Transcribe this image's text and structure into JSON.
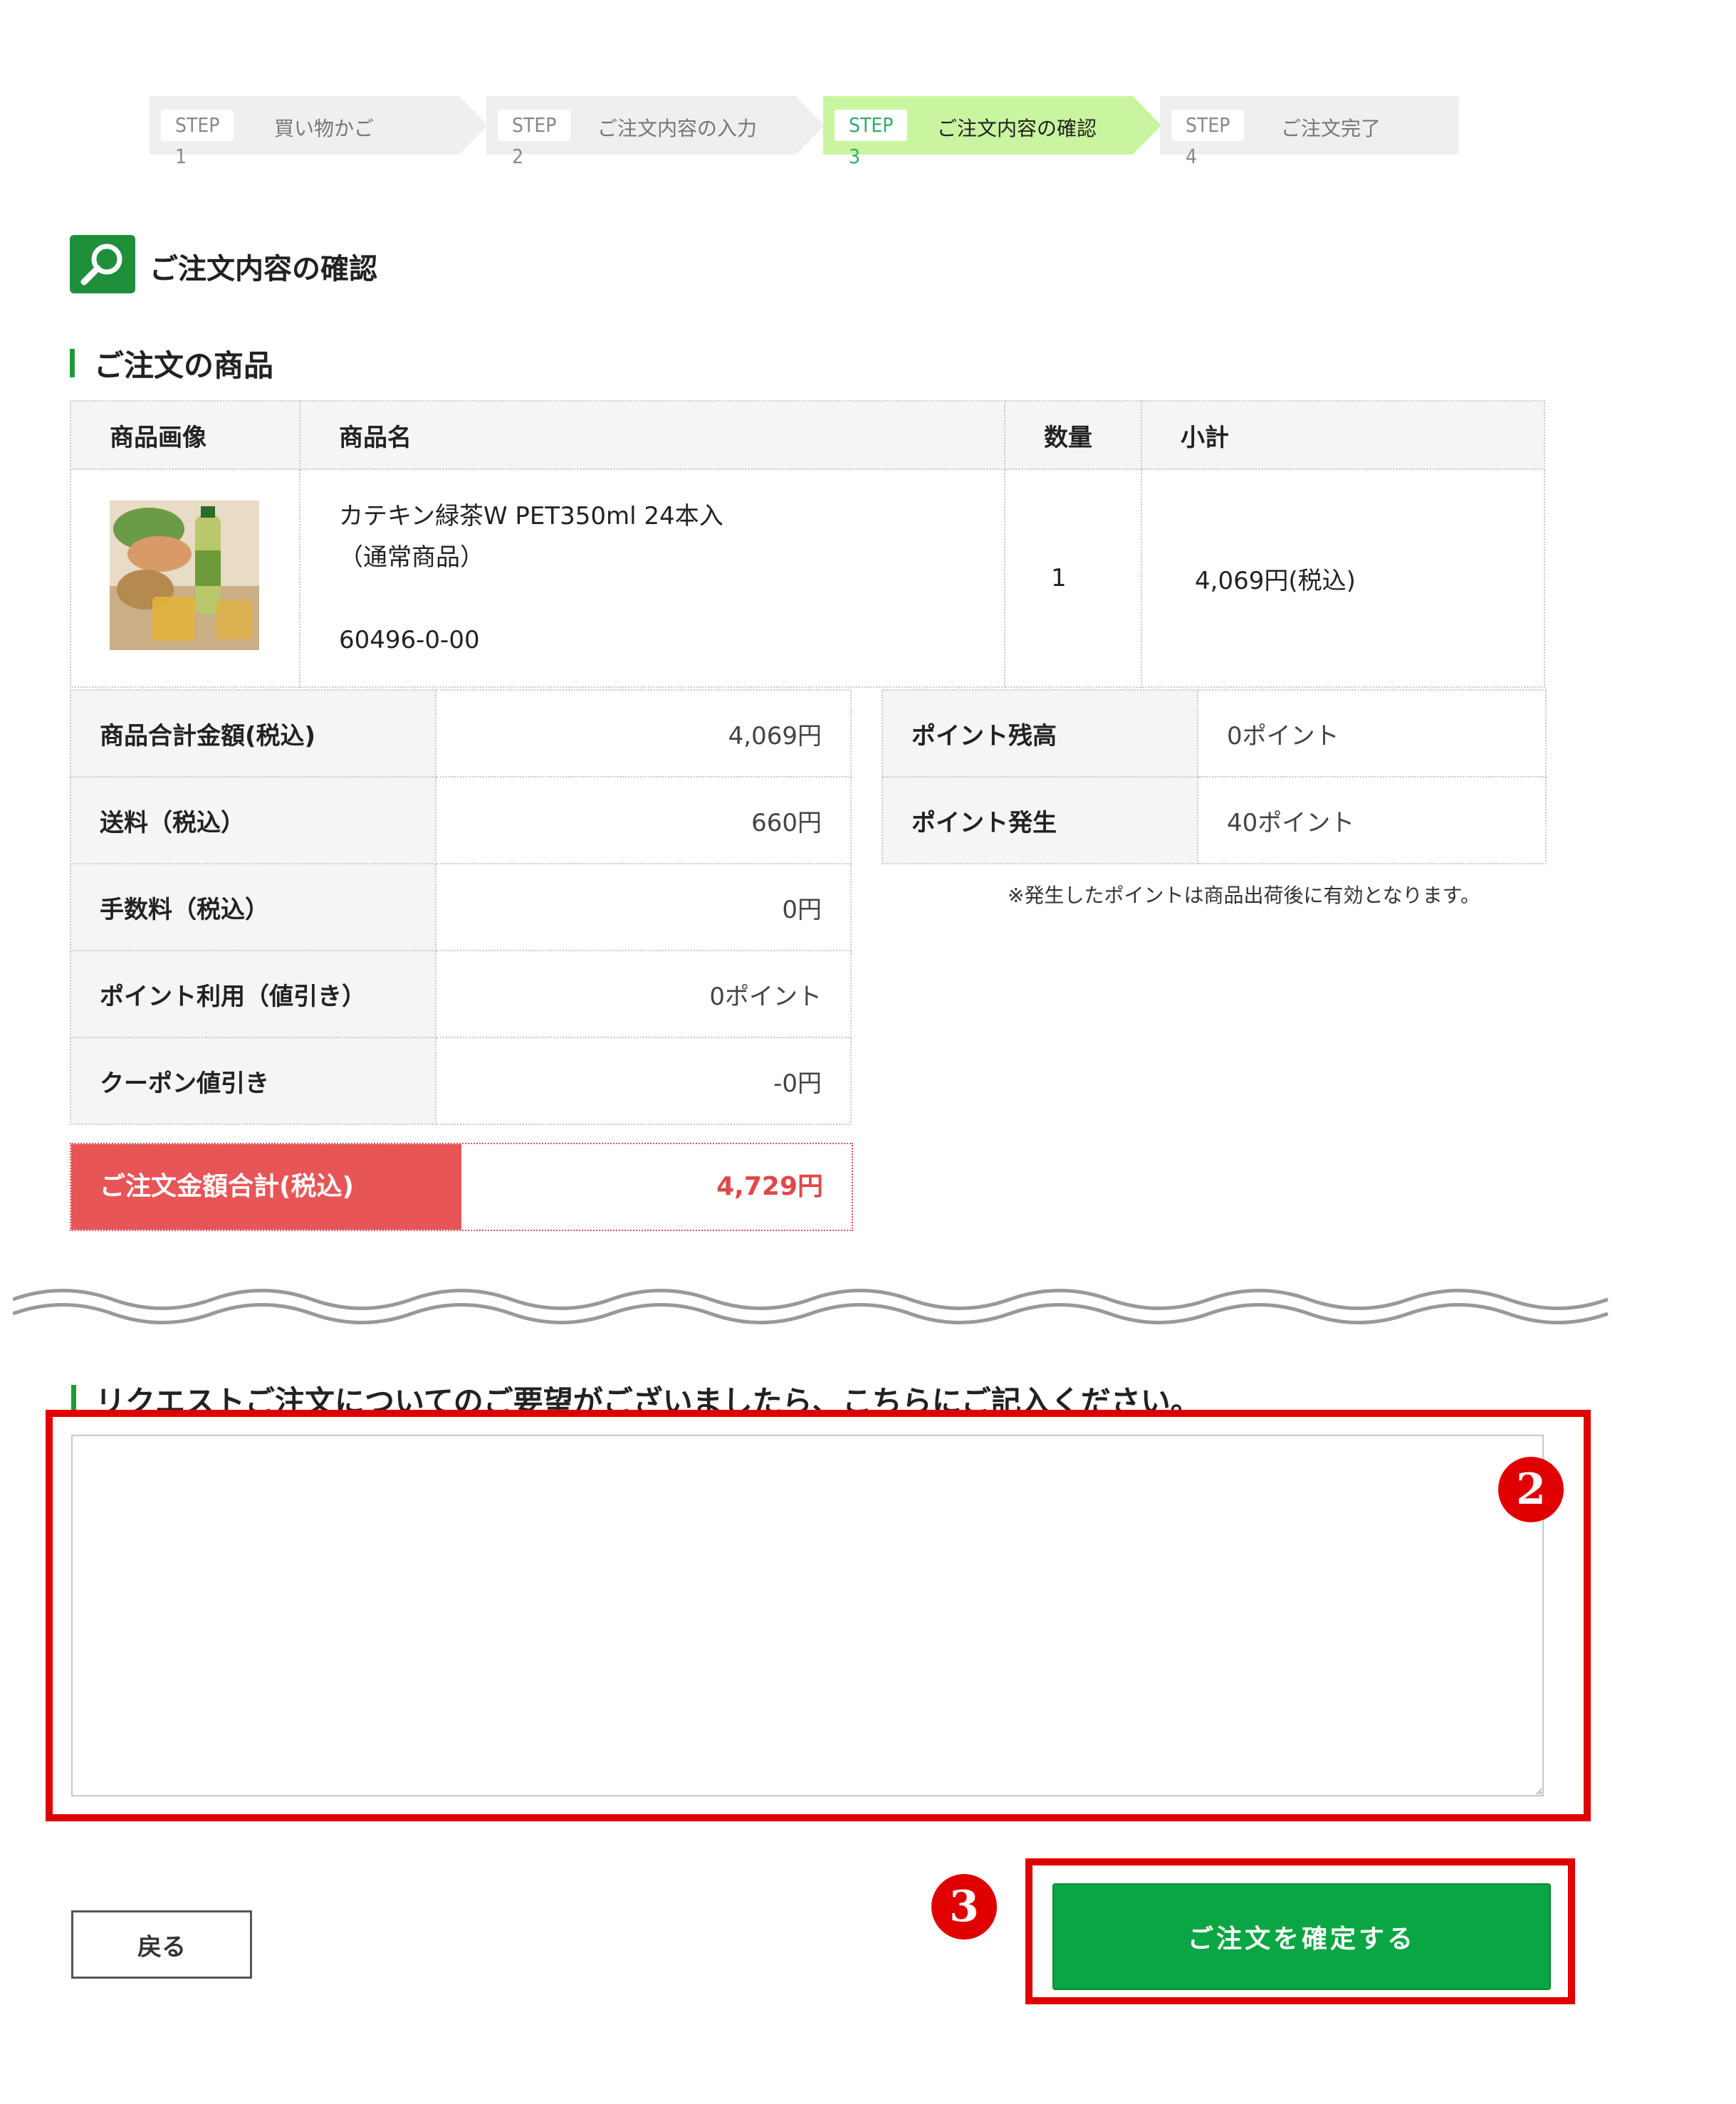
{
  "stepper": {
    "steps": [
      {
        "badge": "STEP 1",
        "label": "買い物かご"
      },
      {
        "badge": "STEP 2",
        "label": "ご注文内容の入力"
      },
      {
        "badge": "STEP 3",
        "label": "ご注文内容の確認"
      },
      {
        "badge": "STEP 4",
        "label": "ご注文完了"
      }
    ],
    "active_index": 2
  },
  "page_title": "ご注文内容の確認",
  "products_section": {
    "title": "ご注文の商品",
    "headers": {
      "image": "商品画像",
      "name": "商品名",
      "qty": "数量",
      "subtotal": "小計"
    },
    "rows": [
      {
        "name": "カテキン緑茶W PET350ml 24本入",
        "type": "（通常商品）",
        "code": "60496-0-00",
        "qty": "1",
        "subtotal": "4,069円(税込)"
      }
    ]
  },
  "summary": {
    "rows": [
      {
        "label": "商品合計金額(税込)",
        "value": "4,069円"
      },
      {
        "label": "送料（税込）",
        "value": "660円"
      },
      {
        "label": "手数料（税込）",
        "value": "0円"
      },
      {
        "label": "ポイント利用（値引き）",
        "value": "0ポイント"
      },
      {
        "label": "クーポン値引き",
        "value": "-0円"
      }
    ],
    "total_label": "ご注文金額合計(税込)",
    "total_value": "4,729円"
  },
  "points": {
    "rows": [
      {
        "label": "ポイント残高",
        "value": "0ポイント"
      },
      {
        "label": "ポイント発生",
        "value": "40ポイント"
      }
    ],
    "note": "※発生したポイントは商品出荷後に有効となります。"
  },
  "request_section": {
    "title": "リクエストご注文についてのご要望がございましたら、こちらにご記入ください。",
    "textarea_value": ""
  },
  "annotations": {
    "marker_2": "2",
    "marker_3": "3",
    "color": "#e00000"
  },
  "buttons": {
    "back": "戻る",
    "confirm": "ご注文を確定する"
  },
  "colors": {
    "accent_green": "#09a643",
    "step_active": "#c9f5a0",
    "step_inactive": "#efefef",
    "total_red": "#e85557"
  }
}
